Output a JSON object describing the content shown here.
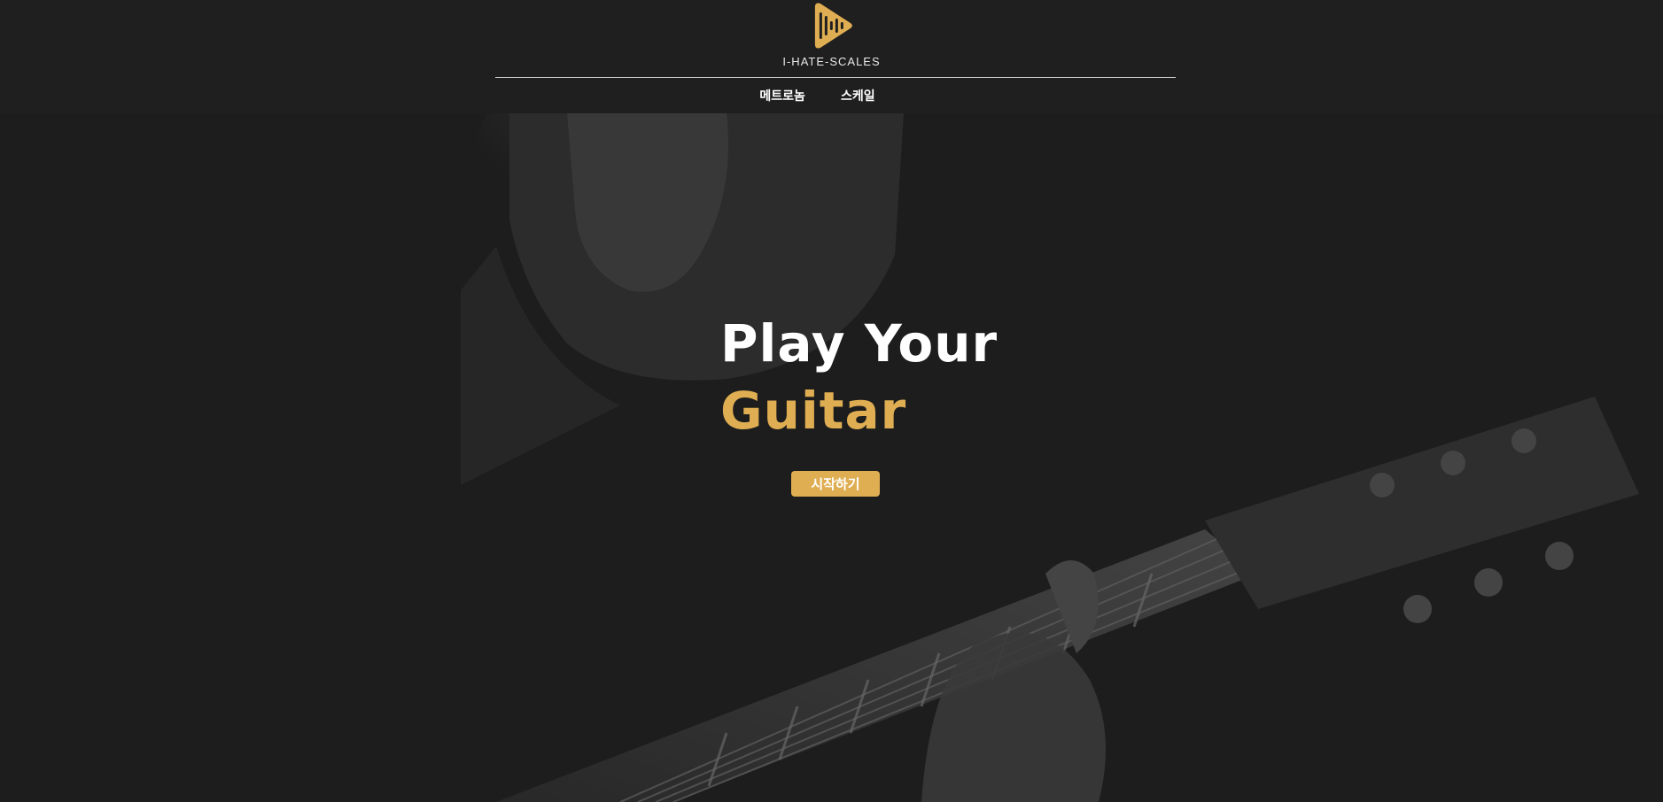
{
  "brand": {
    "name": "I-HATE-SCALES",
    "accent_color": "#e0ae52",
    "icon": "play-soundwave-icon"
  },
  "nav": {
    "items": [
      {
        "label": "메트로놈"
      },
      {
        "label": "스케일"
      }
    ]
  },
  "hero": {
    "title_line1": "Play Your",
    "title_line2": "Guitar",
    "cta_label": "시작하기",
    "background": "guitarist-photo"
  }
}
